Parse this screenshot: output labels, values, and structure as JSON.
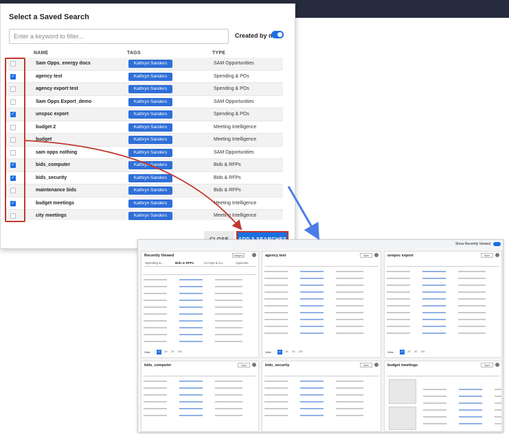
{
  "modal": {
    "title": "Select a Saved Search",
    "filter_placeholder": "Enter a keyword to filter...",
    "created_by_me_label": "Created by me",
    "columns": {
      "name": "NAME",
      "tags": "TAGS",
      "type": "TYPE"
    },
    "rows": [
      {
        "name": "Sam Opps_energy docs",
        "tag": "Kathryn Sanders",
        "type": "SAM Opportunities",
        "checked": false
      },
      {
        "name": "agency test",
        "tag": "Kathryn Sanders",
        "type": "Spending & POs",
        "checked": true
      },
      {
        "name": "agency export test",
        "tag": "Kathryn Sanders",
        "type": "Spending & POs",
        "checked": false
      },
      {
        "name": "Sam Opps Export_demo",
        "tag": "Kathryn Sanders",
        "type": "SAM Opportunities",
        "checked": false
      },
      {
        "name": "unspsc export",
        "tag": "Kathryn Sanders",
        "type": "Spending & POs",
        "checked": true
      },
      {
        "name": "budget 2",
        "tag": "Kathryn Sanders",
        "type": "Meeting Intelligence",
        "checked": false
      },
      {
        "name": "budget",
        "tag": "Kathryn Sanders",
        "type": "Meeting Intelligence",
        "checked": false
      },
      {
        "name": "sam opps nothing",
        "tag": "Kathryn Sanders",
        "type": "SAM Opportunities",
        "checked": false
      },
      {
        "name": "bids_computer",
        "tag": "Kathryn Sanders",
        "type": "Bids & RFPs",
        "checked": true
      },
      {
        "name": "bids_security",
        "tag": "Kathryn Sanders",
        "type": "Bids & RFPs",
        "checked": true
      },
      {
        "name": "maintenance bids",
        "tag": "Kathryn Sanders",
        "type": "Bids & RFPs",
        "checked": false
      },
      {
        "name": "budget meetings",
        "tag": "Kathryn Sanders",
        "type": "Meeting Intelligence",
        "checked": true
      },
      {
        "name": "city meetings",
        "tag": "Kathryn Sanders",
        "type": "Meeting Intelligence",
        "checked": false
      }
    ],
    "close_label": "CLOSE",
    "add_label": "ADD 5 SEARCHES"
  },
  "dashboard": {
    "show_recently_viewed": "Show Recently Viewed",
    "panels": [
      {
        "title": "Recently Viewed",
        "button": "Category",
        "tabs": [
          "Spending &...",
          "Bids & RFPs",
          "Co-Ops & Co...",
          "Agencies"
        ],
        "active_tab": 1
      },
      {
        "title": "agency test",
        "button": "Open"
      },
      {
        "title": "unspsc export",
        "button": "Open"
      },
      {
        "title": "bids_computer",
        "button": "Open"
      },
      {
        "title": "bids_security",
        "button": "Open"
      },
      {
        "title": "budget meetings",
        "button": "Open"
      }
    ],
    "pager_label": "View",
    "pages": [
      "10",
      "25",
      "50",
      "100"
    ]
  },
  "colors": {
    "accent": "#1a6fe0",
    "tag": "#2f6fd8",
    "highlight": "#c0392b",
    "arrow": "#4a7de8"
  }
}
